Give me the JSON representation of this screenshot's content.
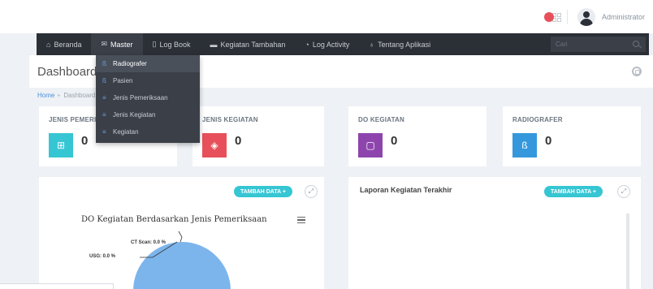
{
  "header": {
    "username": "Administrator",
    "notification_icon": "bell-icon",
    "colors": {
      "badge": "#e7505a"
    }
  },
  "nav": {
    "items": [
      {
        "label": "Beranda",
        "icon": "home-icon"
      },
      {
        "label": "Master",
        "icon": "mail-icon"
      },
      {
        "label": "Log Book",
        "icon": "book-icon"
      },
      {
        "label": "Kegiatan Tambahan",
        "icon": "car-icon"
      },
      {
        "label": "Log Activity",
        "icon": "rss-icon"
      },
      {
        "label": "Tentang Aplikasi",
        "icon": "bulb-icon"
      }
    ],
    "search_placeholder": "Cari",
    "colors": {
      "background": "#2b2f36"
    }
  },
  "dropdown": {
    "items": [
      {
        "label": "Radiografer",
        "icon": "users-icon"
      },
      {
        "label": "Pasien",
        "icon": "users-icon"
      },
      {
        "label": "Jenis Pemeriksaan",
        "icon": "list-icon"
      },
      {
        "label": "Jenis Kegiatan",
        "icon": "list-icon"
      },
      {
        "label": "Kegiatan",
        "icon": "list-icon"
      }
    ]
  },
  "page": {
    "title": "Dashboard",
    "breadcrumb": {
      "home": "Home",
      "current": "Dashboard"
    }
  },
  "stats": [
    {
      "label": "JENIS PEMERIKSAAN",
      "value": "0",
      "icon": "medkit-icon",
      "color": "#36c6d3"
    },
    {
      "label": "JENIS KEGIATAN",
      "value": "0",
      "icon": "layers-icon",
      "color": "#e7505a"
    },
    {
      "label": "DO KEGIATAN",
      "value": "0",
      "icon": "document-icon",
      "color": "#8e44ad"
    },
    {
      "label": "RADIOGRAFER",
      "value": "0",
      "icon": "users-icon",
      "color": "#3598dc"
    }
  ],
  "panels": {
    "left": {
      "add_button": "TAMBAH DATA +",
      "chart": {
        "title": "DO Kegiatan Berdasarkan Jenis Pemeriksaan",
        "labels": [
          {
            "text": "CT Scan: 0.0 %"
          },
          {
            "text": "USG: 0.0 %"
          }
        ],
        "colors": {
          "slice": "#7cb5ec"
        }
      }
    },
    "right": {
      "title": "Laporan Kegiatan Terakhir",
      "add_button": "TAMBAH DATA +"
    }
  },
  "chart_data": {
    "type": "pie",
    "title": "DO Kegiatan Berdasarkan Jenis Pemeriksaan",
    "slices": [
      {
        "label": "CT Scan",
        "percent": 0.0
      },
      {
        "label": "USG",
        "percent": 0.0
      }
    ]
  }
}
